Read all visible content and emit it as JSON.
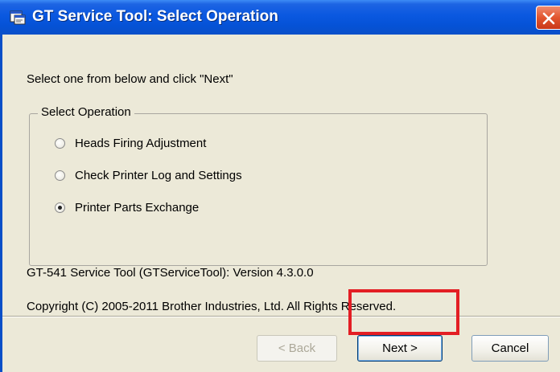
{
  "window": {
    "title": "GT Service Tool: Select Operation",
    "title_icon": "app-window-icon",
    "close_icon": "close-icon"
  },
  "instruction": "Select one from below and click \"Next\"",
  "operation_group": {
    "legend": "Select Operation",
    "options": [
      {
        "label": "Heads Firing Adjustment",
        "checked": false
      },
      {
        "label": "Check Printer Log and Settings",
        "checked": false
      },
      {
        "label": "Printer Parts Exchange",
        "checked": true
      }
    ]
  },
  "info": {
    "version": "GT-541 Service Tool (GTServiceTool): Version 4.3.0.0",
    "copyright": "Copyright (C) 2005-2011 Brother Industries, Ltd. All Rights Reserved."
  },
  "buttons": {
    "back": "< Back",
    "next": "Next >",
    "cancel": "Cancel"
  },
  "colors": {
    "title_bar": "#0a58e0",
    "close_button": "#e2552f",
    "highlight": "#e31e24",
    "window_face": "#ece9d8"
  }
}
